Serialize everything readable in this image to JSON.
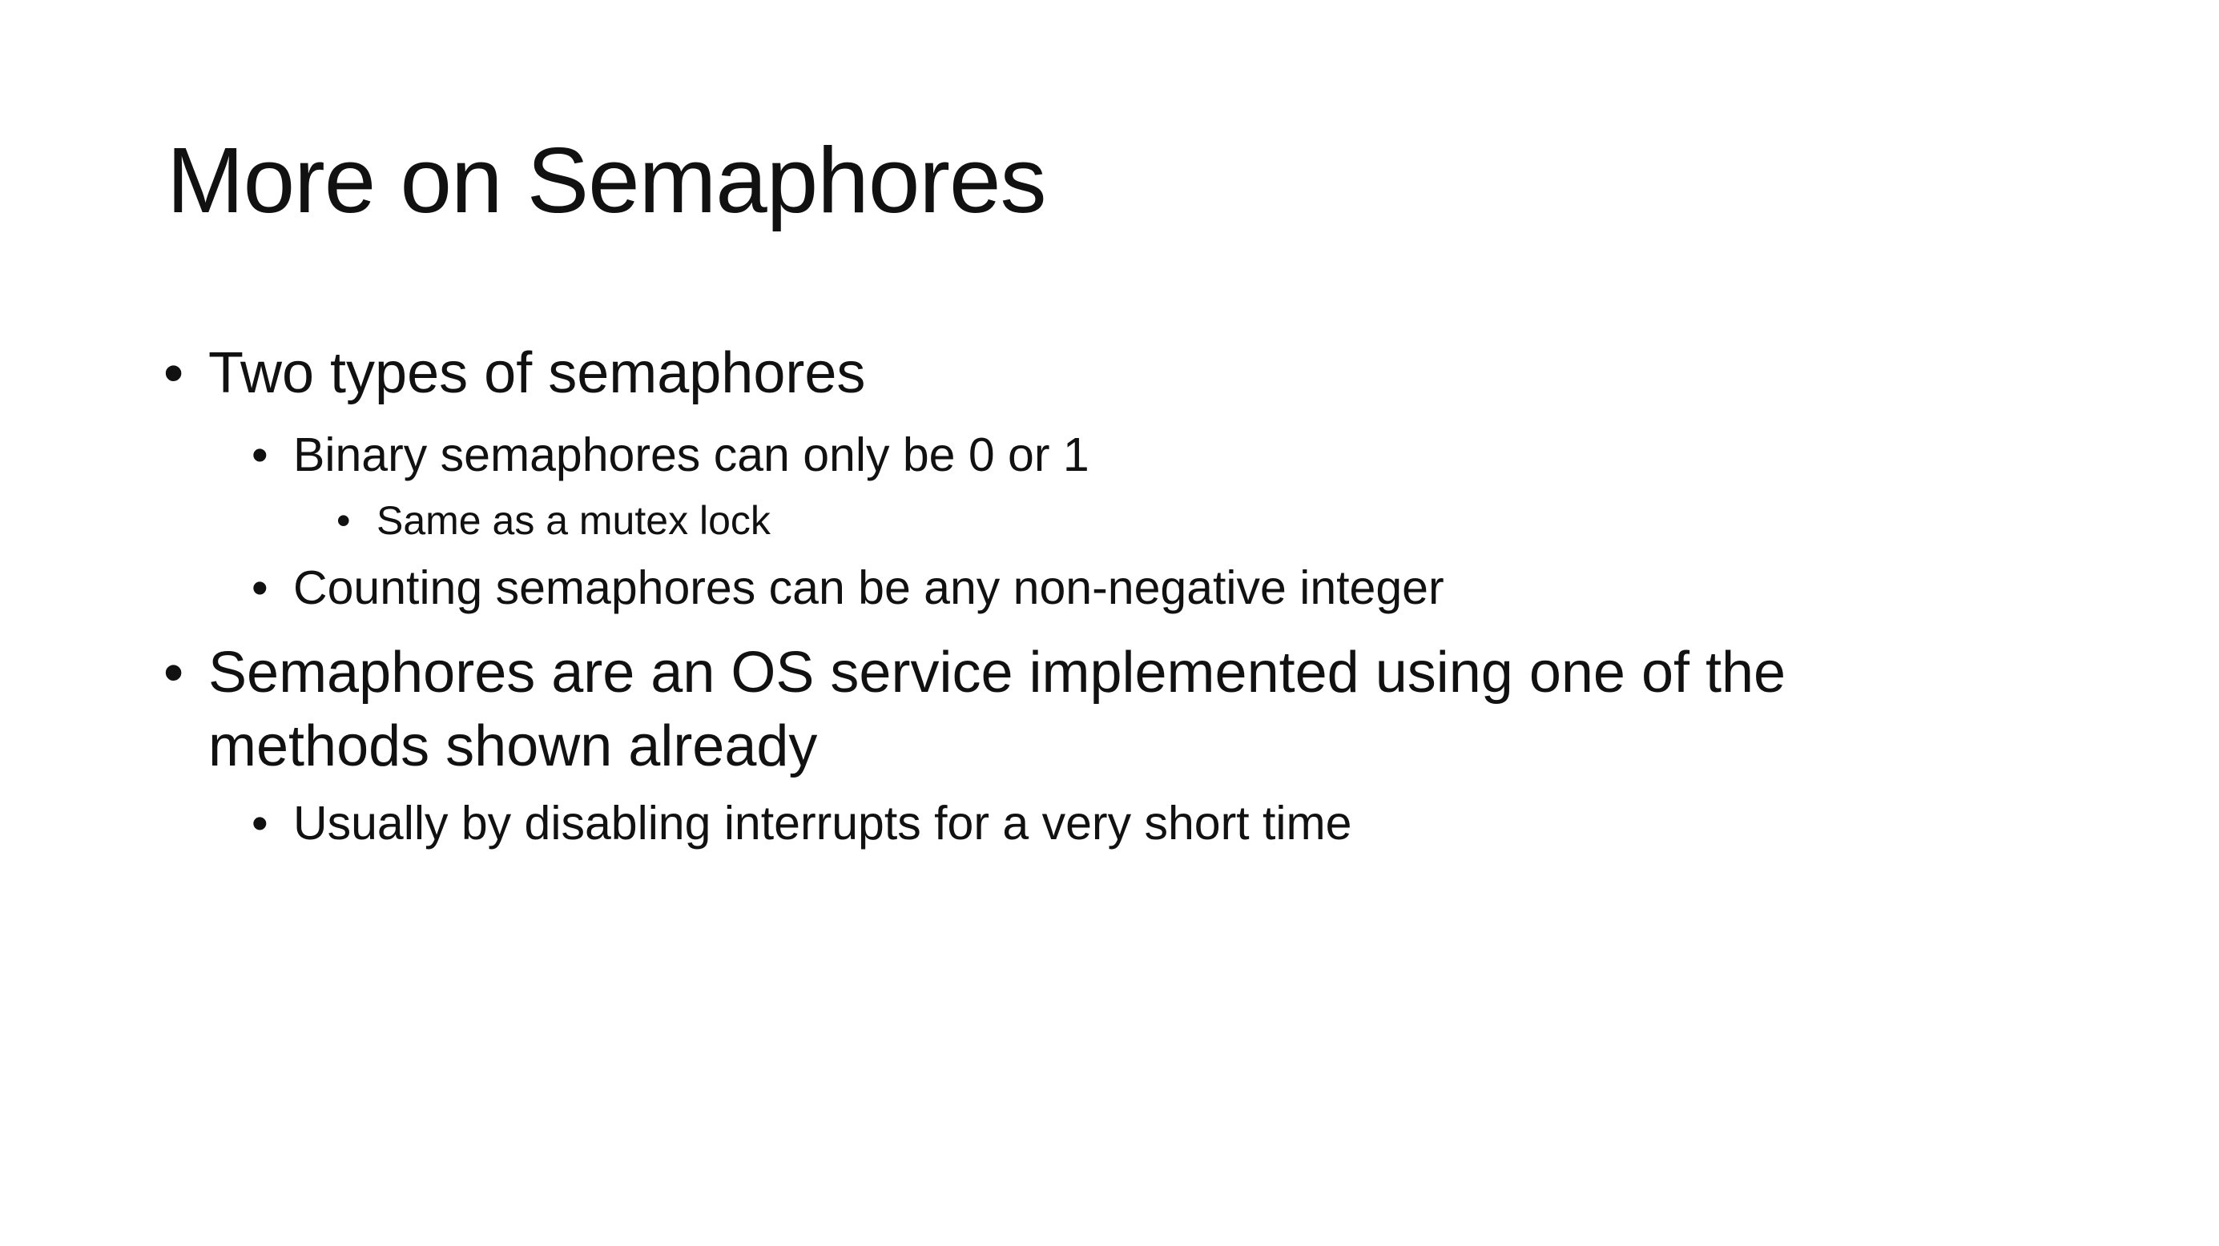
{
  "slide": {
    "title": "More on Semaphores",
    "bullet_glyph": "•",
    "bullets": [
      {
        "text": "Two types of semaphores",
        "children": [
          {
            "text": "Binary semaphores can only be 0 or 1",
            "children": [
              {
                "text": "Same as a mutex lock"
              }
            ]
          },
          {
            "text": "Counting semaphores can be any non-negative integer"
          }
        ]
      },
      {
        "text": "Semaphores are an OS service implemented using one of the methods shown already",
        "children": [
          {
            "text": "Usually by disabling interrupts for a very short time"
          }
        ]
      }
    ]
  }
}
